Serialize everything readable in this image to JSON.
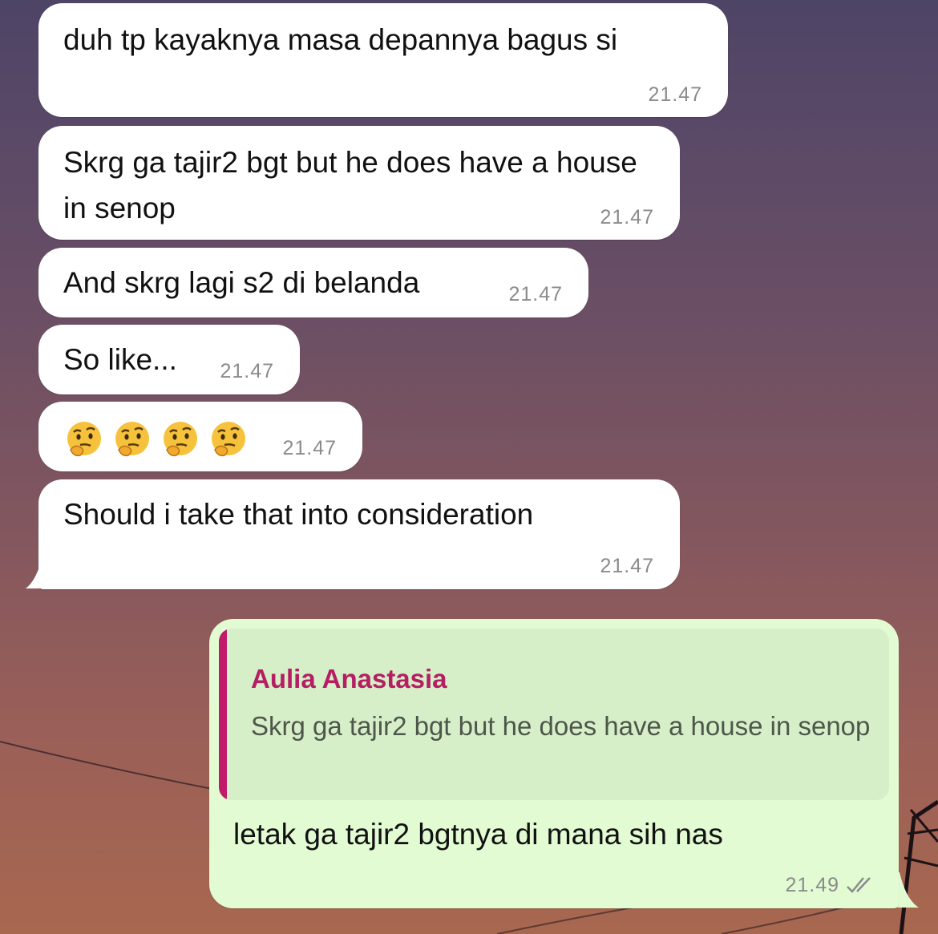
{
  "messages": [
    {
      "text": "duh tp kayaknya masa depannya bagus si",
      "time": "21.47"
    },
    {
      "text": "Skrg ga tajir2 bgt but he does have a house in senop",
      "time": "21.47"
    },
    {
      "text": "And skrg lagi s2 di belanda",
      "time": "21.47"
    },
    {
      "text": "So like...",
      "time": "21.47"
    },
    {
      "emojis": [
        "thinking-face",
        "thinking-face",
        "thinking-face",
        "thinking-face"
      ],
      "time": "21.47"
    },
    {
      "text": "Should i take that into consideration",
      "time": "21.47"
    }
  ],
  "reply": {
    "quoted_name": "Aulia Anastasia",
    "quoted_text": "Skrg ga tajir2 bgt but he does have a house in senop",
    "text": "letak ga tajir2 bgtnya di mana sih nas",
    "time": "21.49",
    "status": "read-double-check"
  },
  "colors": {
    "incoming_bubble": "#ffffff",
    "outgoing_bubble": "#e2fbd3",
    "quote_accent": "#c11a6b",
    "quote_name": "#b51e63",
    "timestamp": "#8b8b8b"
  }
}
